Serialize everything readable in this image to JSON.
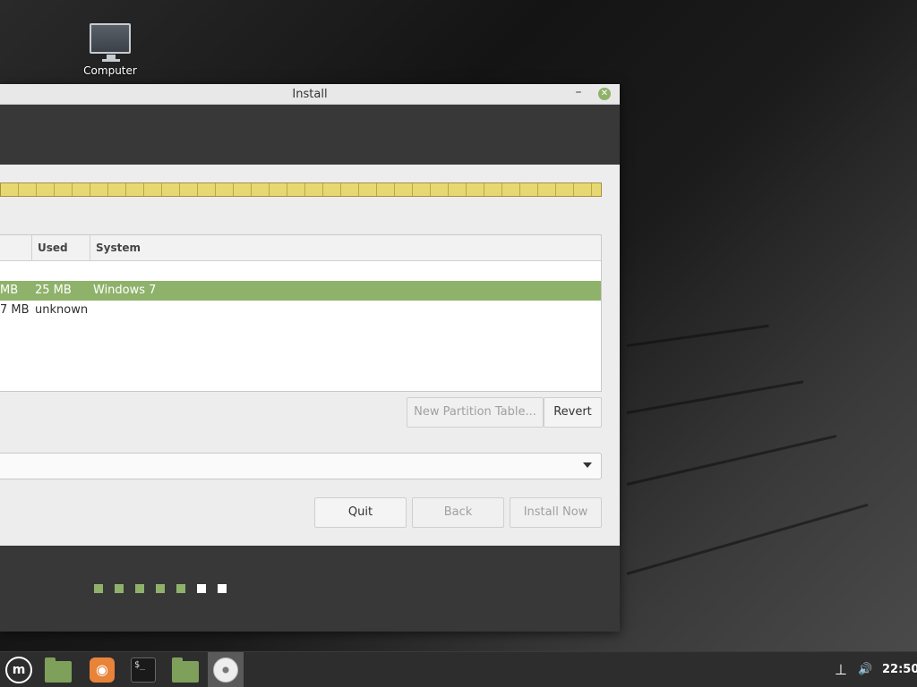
{
  "desktop": {
    "icons": [
      {
        "label": "Computer",
        "icon": "monitor-icon"
      }
    ]
  },
  "window": {
    "title": "Install",
    "controls": {
      "minimize": "–",
      "close": "✕"
    }
  },
  "partition_table": {
    "columns": [
      "Used",
      "System"
    ],
    "rows": [
      {
        "size": "MB",
        "used": "25 MB",
        "system": "Windows 7",
        "selected": true
      },
      {
        "size": "7 MB",
        "used": "unknown",
        "system": "",
        "selected": false
      }
    ]
  },
  "buttons": {
    "new_partition_table": "New Partition Table...",
    "revert": "Revert",
    "quit": "Quit",
    "back": "Back",
    "install_now": "Install Now"
  },
  "progress": {
    "total_steps": 7,
    "completed_steps": 5
  },
  "taskbar": {
    "menu_logo": "mint-menu-icon",
    "apps": [
      "show-desktop-icon",
      "firefox-icon",
      "terminal-icon",
      "files-icon",
      "installer-disc-icon"
    ],
    "clock": "22:50",
    "network_symbol": "⊥",
    "volume_symbol": "🔊"
  },
  "colors": {
    "accent": "#8fb26b",
    "window_dark": "#383838",
    "content_bg": "#ededed",
    "disk_bar": "#e8d872"
  }
}
